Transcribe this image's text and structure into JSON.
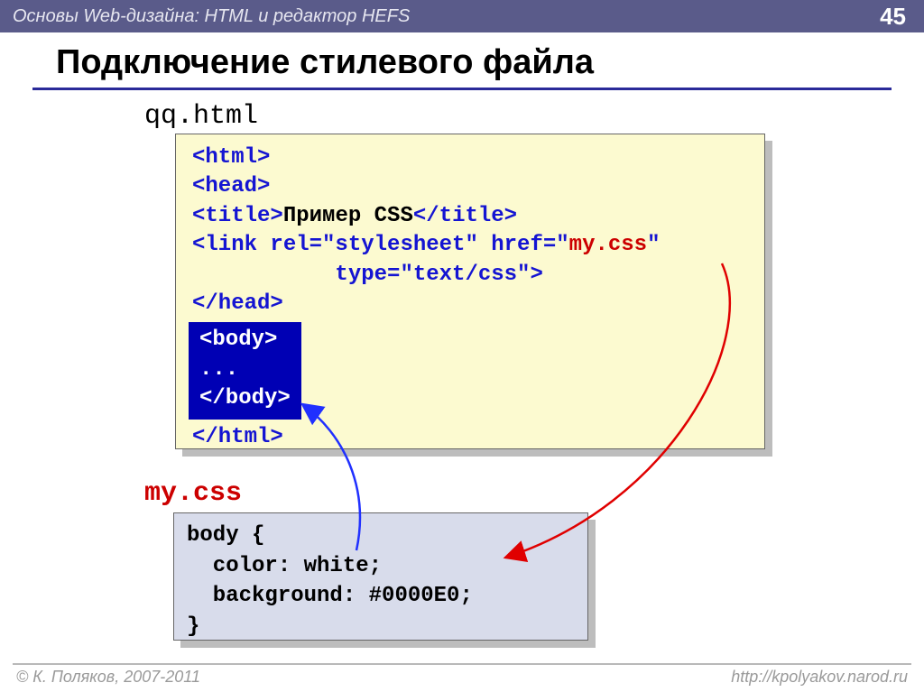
{
  "header": {
    "title": "Основы Web-дизайна: HTML и редактор HEFS",
    "page": "45"
  },
  "title": "Подключение стилевого файла",
  "file1": {
    "name": "qq.html",
    "l1": "<html>",
    "l2": "<head>",
    "l3a": "<title>",
    "l3b": "Пример CSS",
    "l3c": "</title>",
    "l4a": "<link rel=\"stylesheet\" href=\"",
    "l4b": "my.css",
    "l4c": "\"",
    "l5": "           type=\"text/css\">",
    "l6": "</head>",
    "body1": "<body>",
    "body2": "...",
    "body3": "</body>",
    "l7": "</html>"
  },
  "file2": {
    "name": "my.css",
    "code": "body {\n  color: white;\n  background: #0000E0;\n}"
  },
  "footer": {
    "left": "© К. Поляков, 2007-2011",
    "right": "http://kpolyakov.narod.ru"
  }
}
